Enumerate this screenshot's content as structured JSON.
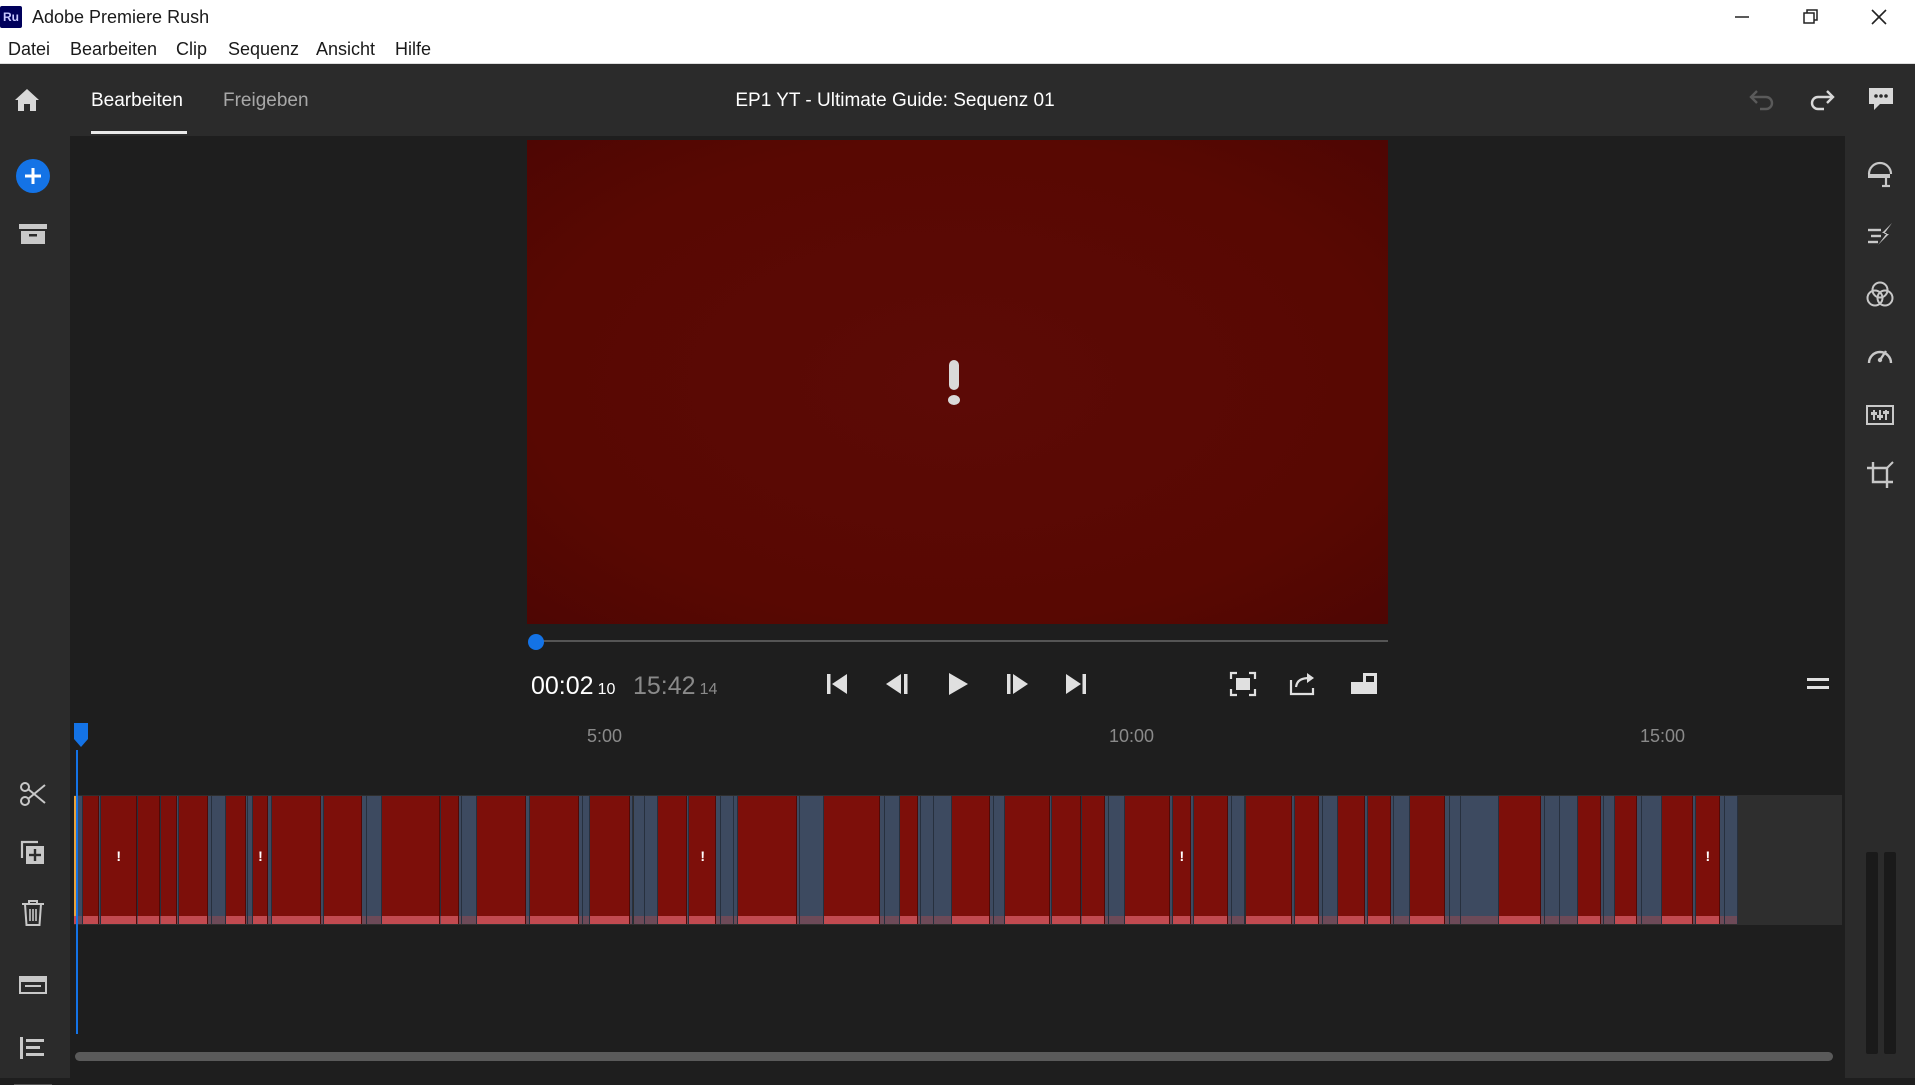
{
  "window": {
    "app_logo": "Ru",
    "title": "Adobe Premiere Rush",
    "controls": [
      "minimize-icon",
      "restore-icon",
      "close-icon"
    ]
  },
  "menubar": {
    "items": [
      {
        "label": "Datei"
      },
      {
        "label": "Bearbeiten"
      },
      {
        "label": "Clip"
      },
      {
        "label": "Sequenz"
      },
      {
        "label": "Ansicht"
      },
      {
        "label": "Hilfe"
      }
    ]
  },
  "header": {
    "tabs": [
      {
        "label": "Bearbeiten",
        "active": true
      },
      {
        "label": "Freigeben",
        "active": false
      }
    ],
    "sequence_title": "EP1 YT - Ultimate Guide: Sequenz 01",
    "icons": [
      "home-icon",
      "undo-icon",
      "redo-icon",
      "comments-icon"
    ]
  },
  "left_toolbar": {
    "icons": [
      "add-media-icon",
      "project-assets-icon",
      "split-clip-icon",
      "duplicate-icon",
      "delete-icon",
      "track-controls-icon",
      "timeline-list-icon"
    ]
  },
  "right_toolbar": {
    "icons": [
      "titles-icon",
      "transitions-icon",
      "color-icon",
      "speed-icon",
      "audio-icon",
      "transform-crop-icon"
    ]
  },
  "player": {
    "current_time": "00:02",
    "current_frame": "10",
    "duration_time": "15:42",
    "duration_frame": "14",
    "progress": 0.002,
    "state": "offline-media-warning",
    "controls": [
      "go-to-start-icon",
      "step-back-icon",
      "play-icon",
      "step-forward-icon",
      "go-to-end-icon",
      "fullscreen-icon",
      "export-frame-icon",
      "aspect-ratio-icon",
      "panel-menu-icon"
    ]
  },
  "timeline": {
    "ruler_labels": [
      "5:00",
      "10:00",
      "15:00"
    ],
    "clip_warning_mark": "!",
    "colors": {
      "offline_clip": "#7d0f0a",
      "media_clip": "#3d4a60",
      "audio_strip": "#c24a50",
      "accent": "#1473e6",
      "selected_clip": "#e8a23a"
    }
  }
}
